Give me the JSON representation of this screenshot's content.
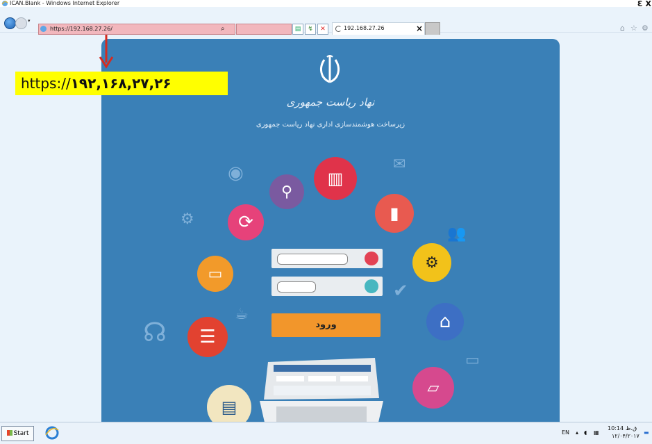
{
  "window": {
    "title": "ICAN.Blank - Windows Internet Explorer",
    "controls": {
      "minimize": "_",
      "restore": "Ɛ",
      "close": "X"
    }
  },
  "browser": {
    "address": "https://192.168.27.26/",
    "search_glyph": "⌕",
    "tab": {
      "label": "192.168.27.26",
      "close": "×"
    },
    "right_icons": [
      "home-icon",
      "star-icon",
      "gear-icon"
    ]
  },
  "annotation": {
    "callout_prefix": "https://",
    "callout_digits": "۱۹۲,۱۶۸,۲۷,۲۶",
    "arrow_color": "#d62b1f",
    "callout_bg": "#ffff00"
  },
  "portal": {
    "brand": "نهاد ریاست جمهوری",
    "subtitle": "زیرساخت هوشمندسازی اداری نهاد ریاست جمهوری",
    "login_button": "ورود",
    "background_color": "#3a80b7",
    "username_value": "",
    "password_value": ""
  },
  "taskbar": {
    "start_label": "Start",
    "lang": "EN",
    "time": "10:14",
    "ampm": "ق.ظ",
    "date": "۱۲/۰۴/۲۰۱۷"
  }
}
